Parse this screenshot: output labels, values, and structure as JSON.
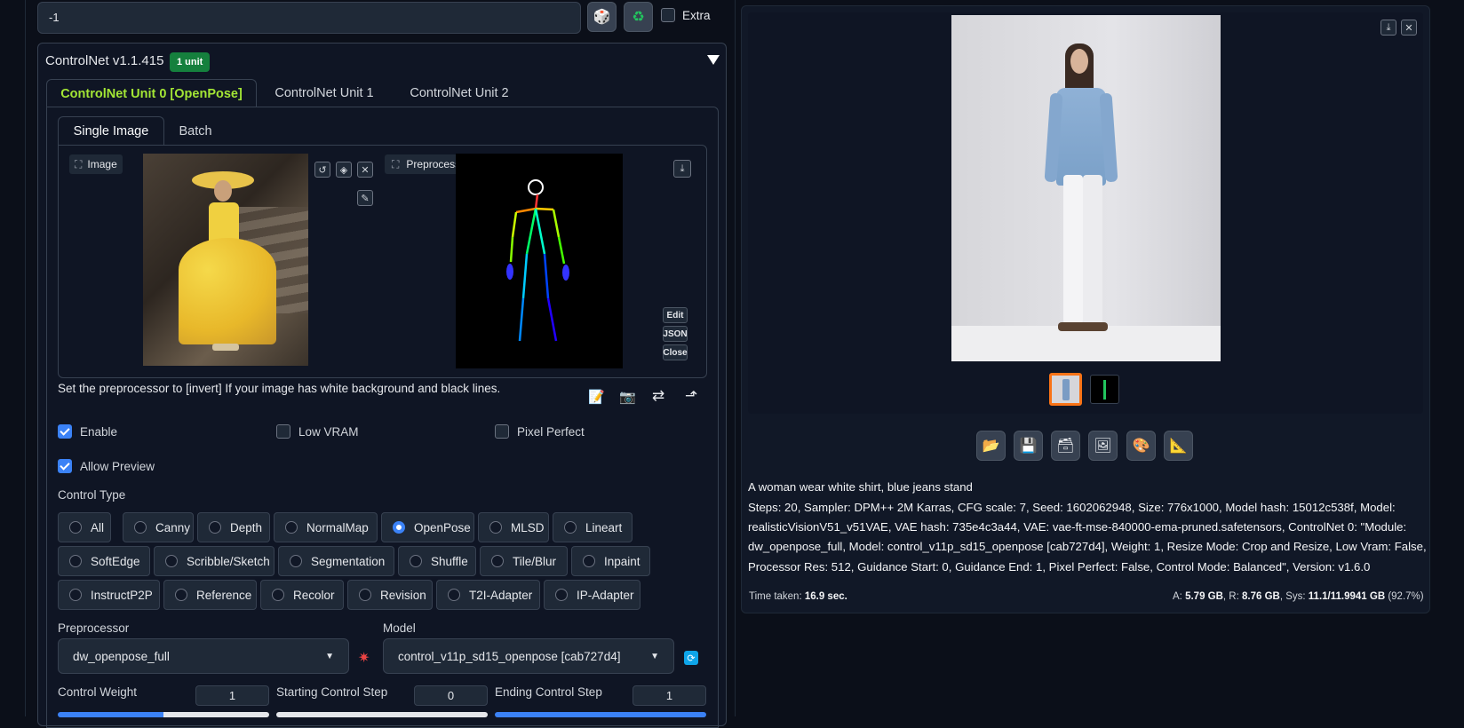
{
  "seed": {
    "value": "-1",
    "extra_label": "Extra"
  },
  "controlnet": {
    "title": "ControlNet v1.1.415",
    "units_badge": "1 unit",
    "unit_tabs": [
      "ControlNet Unit 0 [OpenPose]",
      "ControlNet Unit 1",
      "ControlNet Unit 2"
    ],
    "mode_tabs": [
      "Single Image",
      "Batch"
    ],
    "image_label": "Image",
    "preview_label": "Preprocessor Preview",
    "preview_buttons": [
      "Edit",
      "JSON",
      "Close"
    ],
    "hint": "Set the preprocessor to [invert] If your image has white background and black lines.",
    "checkboxes": {
      "enable": "Enable",
      "low_vram": "Low VRAM",
      "pixel_perfect": "Pixel Perfect",
      "allow_preview": "Allow Preview"
    },
    "control_type_label": "Control Type",
    "control_types_row1": [
      "All",
      "Canny",
      "Depth",
      "NormalMap",
      "OpenPose",
      "MLSD",
      "Lineart"
    ],
    "control_types_row2": [
      "SoftEdge",
      "Scribble/Sketch",
      "Segmentation",
      "Shuffle",
      "Tile/Blur",
      "Inpaint"
    ],
    "control_types_row3": [
      "InstructP2P",
      "Reference",
      "Recolor",
      "Revision",
      "T2I-Adapter",
      "IP-Adapter"
    ],
    "selected_control_type": "OpenPose",
    "preprocessor_label": "Preprocessor",
    "preprocessor_value": "dw_openpose_full",
    "model_label": "Model",
    "model_value": "control_v11p_sd15_openpose [cab727d4]",
    "control_weight_label": "Control Weight",
    "control_weight": "1",
    "starting_step_label": "Starting Control Step",
    "starting_step": "0",
    "ending_step_label": "Ending Control Step",
    "ending_step": "1"
  },
  "output": {
    "prompt": "A woman wear white shirt, blue jeans stand",
    "params_line1": "Steps: 20, Sampler: DPM++ 2M Karras, CFG scale: 7, Seed: 1602062948, Size: 776x1000, Model hash: 15012c538f, Model:",
    "params_line2": "realisticVisionV51_v51VAE, VAE hash: 735e4c3a44, VAE: vae-ft-mse-840000-ema-pruned.safetensors, ControlNet 0: \"Module:",
    "params_line3": "dw_openpose_full, Model: control_v11p_sd15_openpose [cab727d4], Weight: 1, Resize Mode: Crop and Resize, Low Vram: False,",
    "params_line4": "Processor Res: 512, Guidance Start: 0, Guidance End: 1, Pixel Perfect: False, Control Mode: Balanced\", Version: v1.6.0",
    "time_label": "Time taken:",
    "time_value": "16.9 sec.",
    "mem_a_label": "A:",
    "mem_a": "5.79 GB",
    "mem_r_label": "R:",
    "mem_r": "8.76 GB",
    "mem_sys_label": "Sys:",
    "mem_sys": "11.1/11.9941 GB",
    "mem_pct": "(92.7%)"
  },
  "colors": {
    "accent_green": "#a3e635",
    "badge_green": "#15803d",
    "selection_orange": "#f97316",
    "blue": "#3b82f6"
  }
}
